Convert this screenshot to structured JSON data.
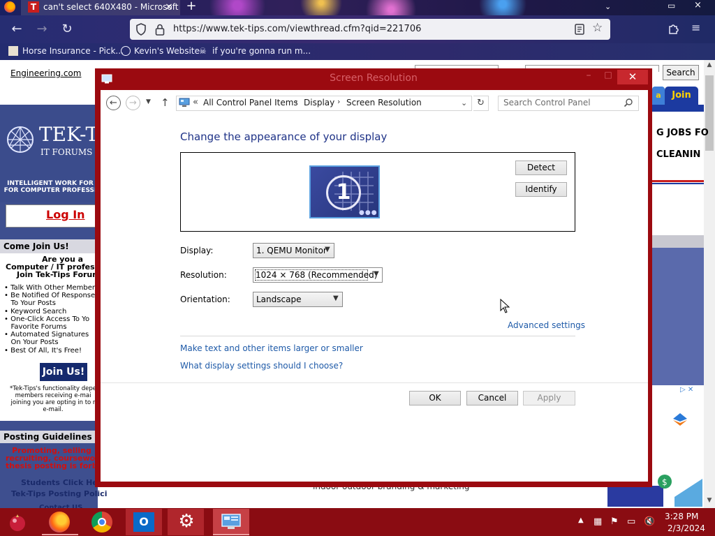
{
  "browser": {
    "tab_title": "can't select 640X480 - Microsoft",
    "url": "https://www.tek-tips.com/viewthread.cfm?qid=221706",
    "bookmarks": [
      {
        "label": "Horse Insurance - Pick..."
      },
      {
        "label": "Kevin's Website"
      },
      {
        "label": "if you're gonna run m..."
      }
    ]
  },
  "webpage": {
    "engineering_link": "Engineering.com",
    "logo_title": "TEK-T",
    "logo_sub": "IT FORUMS",
    "intelligent_work": "INTELLIGENT WORK FOR\nFOR COMPUTER PROFESSI",
    "login": "Log In",
    "come_join": "Come Join Us!",
    "are_you": "Are you a",
    "computer_it": "Computer / IT professi",
    "join_forums": "Join Tek-Tips Forum",
    "join_list": [
      "• Talk With Other Members",
      "• Be Notified Of Response",
      "   To Your Posts",
      "• Keyword Search",
      "• One-Click Access To Yo",
      "   Favorite Forums",
      "• Automated Signatures",
      "   On Your Posts",
      "• Best Of All, It's Free!"
    ],
    "join_button": "Join Us!",
    "tek_note": "*Tek-Tips's functionality depe\nmembers receiving e-mai\njoining you are opting in to r\ne-mail.",
    "posting_guidelines": "Posting Guidelines",
    "promo": "Promoting, selling\nrecruiting, coursework\nthesis posting is forbid",
    "students": "Students Click Here",
    "tek_policy": "Tek-Tips Posting Polici",
    "contact": "Contact US",
    "search_button": "Search",
    "join_tab": "Join",
    "jobs": "G JOBS FO",
    "cleaning": "CLEANIN",
    "bottom_text": "indoor outdoor branding & marketing"
  },
  "dialog": {
    "title": "Screen Resolution",
    "breadcrumbs": [
      "All Control Panel Items",
      "Display",
      "Screen Resolution"
    ],
    "breadcrumb_prefix": "«",
    "search_placeholder": "Search Control Panel",
    "heading": "Change the appearance of your display",
    "monitor_number": "1",
    "detect": "Detect",
    "identify": "Identify",
    "display_label": "Display:",
    "display_value": "1. QEMU Monitor",
    "resolution_label": "Resolution:",
    "resolution_value": "1024 × 768 (Recommended)",
    "orientation_label": "Orientation:",
    "orientation_value": "Landscape",
    "advanced": "Advanced settings",
    "larger_link": "Make text and other items larger or smaller",
    "which_link": "What display settings should I choose?",
    "ok": "OK",
    "cancel": "Cancel",
    "apply": "Apply"
  },
  "taskbar": {
    "time": "3:28 PM",
    "date": "2/3/2024"
  },
  "colors": {
    "dialog_frame": "#9b0a10",
    "taskbar": "#8a0c12",
    "link": "#1e5aa8",
    "heading": "#1e3287"
  }
}
